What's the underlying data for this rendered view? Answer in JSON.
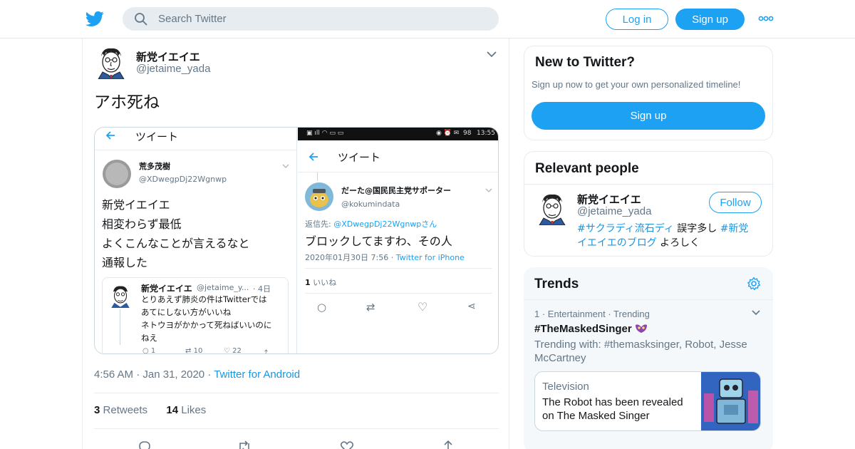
{
  "header": {
    "logo_icon": "twitter-bird-icon",
    "search_placeholder": "Search Twitter",
    "login_label": "Log in",
    "signup_label": "Sign up",
    "more_icon": "more-dots-icon",
    "brand_color": "#1da1f2"
  },
  "tweet": {
    "author_name": "新党イエイエ",
    "author_handle": "@jetaime_yada",
    "text": "アホ死ね",
    "time": "4:56 AM",
    "date": "Jan 31, 2020",
    "source": "Twitter for Android",
    "retweets_count": "3",
    "retweets_label": "Retweets",
    "likes_count": "14",
    "likes_label": "Likes",
    "media": {
      "left": {
        "header": "ツイート",
        "user_name": "荒多茂樹",
        "user_handle": "@XDwegpDj22Wgnwp",
        "lines": [
          "新党イエイエ",
          "相変わらず最低",
          "よくこんなことが言えるなと",
          "通報した"
        ],
        "quoted": {
          "name": "新党イエイエ",
          "handle": "@jetaime_y...",
          "age": "· 4日",
          "lines": [
            "とりあえず肺炎の件はTwitterでは",
            "あてにしない方がいいね",
            "ネトウヨがかかって死ねばいいのに",
            "ねえ"
          ],
          "reply_count": "1",
          "retweet_count": "10",
          "like_count": "22"
        }
      },
      "right": {
        "status_time": "13:55",
        "status_battery": "98",
        "header": "ツイート",
        "user_name": "だーた@国民民主党サポーター",
        "user_handle": "@kokumindata",
        "reply_to_prefix": "返信先:",
        "reply_to_handle": "@XDwegpDj22Wgnwpさん",
        "text": "ブロックしてますわ、その人",
        "timestamp": "2020年01月30日 7:56",
        "source": "Twitter for iPhone",
        "likes_count": "1",
        "likes_label": "いいね"
      }
    }
  },
  "sidebar": {
    "new_to_twitter": {
      "title": "New to Twitter?",
      "subtitle": "Sign up now to get your own personalized timeline!",
      "button": "Sign up"
    },
    "relevant_people": {
      "title": "Relevant people",
      "name": "新党イエイエ",
      "handle": "@jetaime_yada",
      "follow_label": "Follow",
      "bio_tag1": "#サクラディ流石ディ",
      "bio_text1": " 誤字多し ",
      "bio_tag2_a": "#新党",
      "bio_tag2_b": "イエイエのブログ",
      "bio_text2": " よろしく"
    },
    "trends": {
      "title": "Trends",
      "item": {
        "rank": "1",
        "category": "Entertainment · Trending",
        "hashtag": "#TheMaskedSinger",
        "trending_with_1": "Trending with: #themasksinger, Robot, Jesse",
        "trending_with_2": "McCartney",
        "story_category": "Television",
        "story_title_1": "The Robot has been revealed",
        "story_title_2": "on The Masked Singer"
      }
    }
  }
}
